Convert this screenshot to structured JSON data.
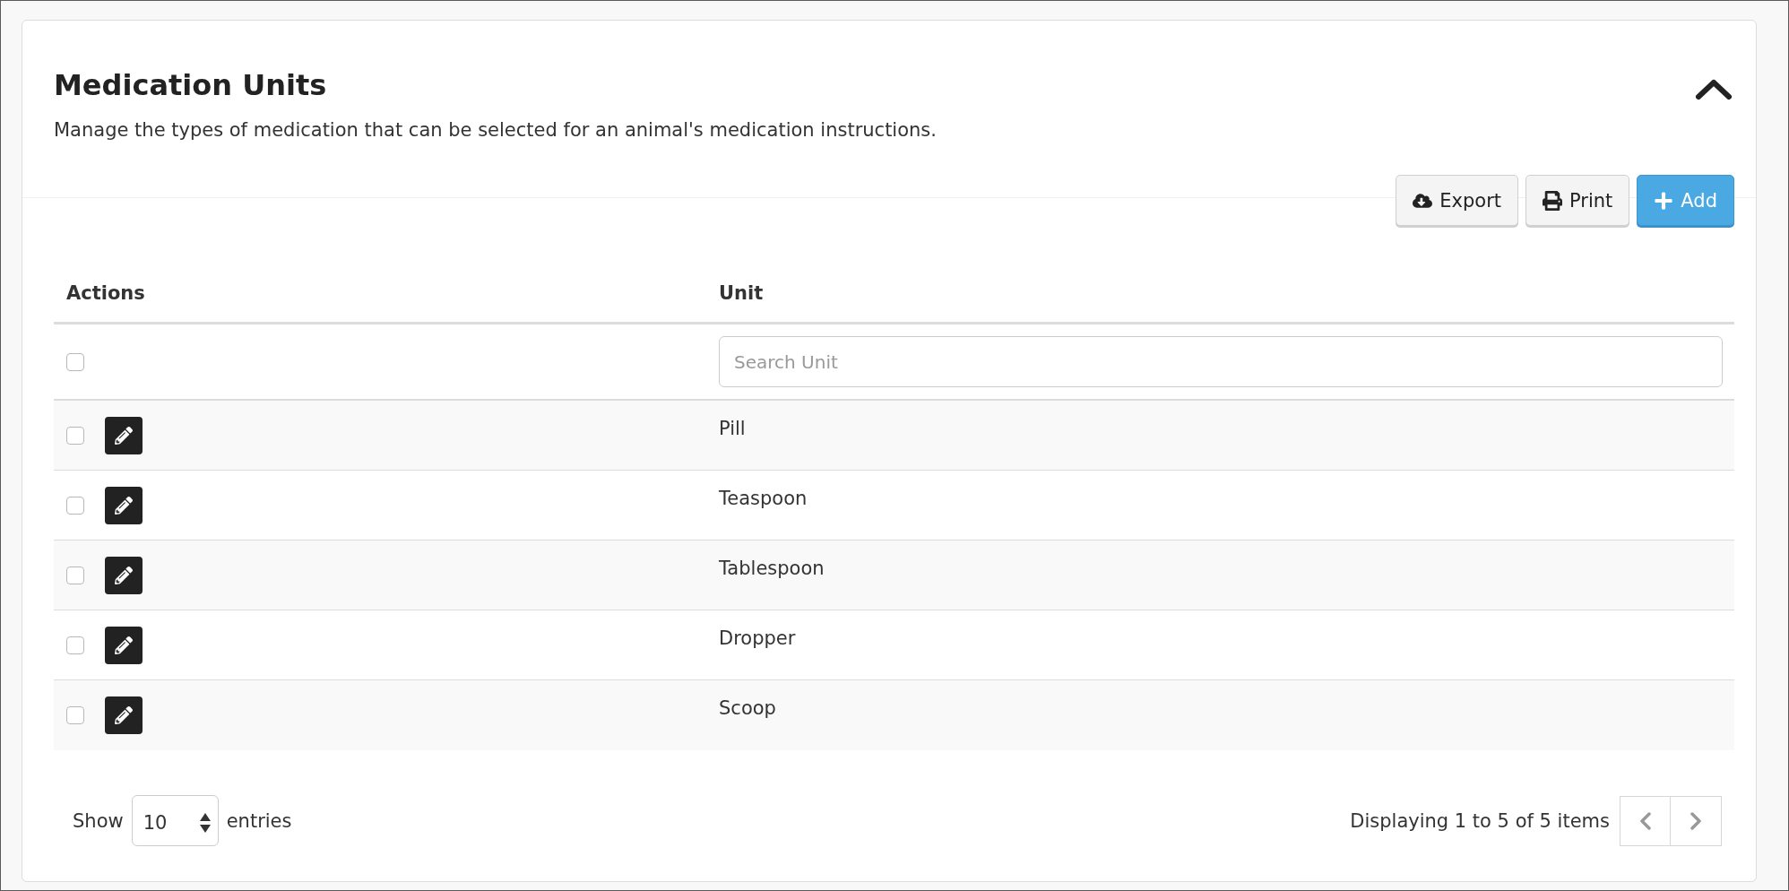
{
  "panel": {
    "title": "Medication Units",
    "description": "Manage the types of medication that can be selected for an animal's medication instructions.",
    "expanded": true
  },
  "toolbar": [
    {
      "kind": "export",
      "label": "Export"
    },
    {
      "kind": "print",
      "label": "Print"
    },
    {
      "kind": "add",
      "label": "Add"
    }
  ],
  "table": {
    "columns": [
      "Actions",
      "Unit"
    ],
    "select_all": {
      "checked": false
    },
    "search": {
      "placeholder": "Search Unit"
    },
    "rows": [
      {
        "unit": "Pill",
        "checked": false
      },
      {
        "unit": "Teaspoon",
        "checked": false
      },
      {
        "unit": "Tablespoon",
        "checked": false
      },
      {
        "unit": "Dropper",
        "checked": false
      },
      {
        "unit": "Scoop",
        "checked": false
      }
    ]
  },
  "footer": {
    "show_label": "Show",
    "page_size": "10",
    "entries_label": "entries",
    "summary": "Displaying 1 to 5 of 5 items"
  }
}
